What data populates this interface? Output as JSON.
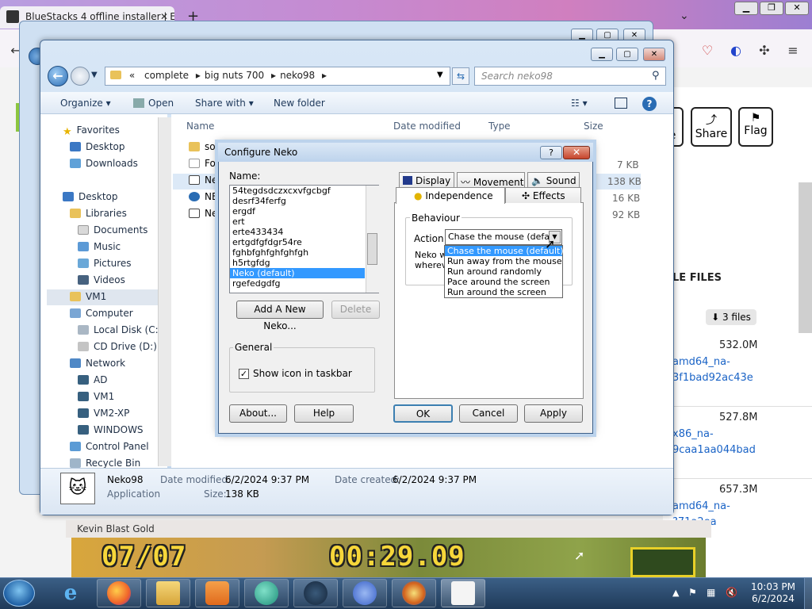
{
  "browser": {
    "tab_title": "BlueStacks 4 offline installer | E",
    "tab_close": "✕",
    "new_tab": "+",
    "page_buttons": [
      {
        "icon": "share-icon",
        "label": "Share"
      },
      {
        "icon": "flag-icon",
        "label": "Flag"
      }
    ],
    "partial_button_label": "e",
    "files_heading": "LE FILES",
    "files_count": "3 files",
    "files": [
      {
        "name_lines": [
          "amd64_na-",
          "3f1bad92ac43e"
        ],
        "size": "532.0M"
      },
      {
        "name_lines": [
          "x86_na-",
          "9caa1aa044bad"
        ],
        "size": "527.8M"
      },
      {
        "name_lines": [
          "amd64_na-",
          "?71a2ea"
        ],
        "size": "657.3M"
      }
    ]
  },
  "explorer": {
    "breadcrumb": [
      "«",
      "complete",
      "big nuts 700",
      "neko98"
    ],
    "search_placeholder": "Search neko98",
    "toolbar": {
      "organize": "Organize",
      "open": "Open",
      "share_with": "Share with",
      "new_folder": "New folder"
    },
    "nav": {
      "favorites": "Favorites",
      "desktop_fav": "Desktop",
      "downloads": "Downloads",
      "desktop": "Desktop",
      "libraries": "Libraries",
      "documents": "Documents",
      "music": "Music",
      "pictures": "Pictures",
      "videos": "Videos",
      "vm1_home": "VM1",
      "computer": "Computer",
      "local_disk": "Local Disk (C:)",
      "cd_drive": "CD Drive (D:)",
      "network": "Network",
      "ad": "AD",
      "vm1": "VM1",
      "vm2": "VM2-XP",
      "windows": "WINDOWS",
      "control_panel": "Control Panel",
      "recycle_bin": "Recycle Bin"
    },
    "columns": {
      "name": "Name",
      "date": "Date modified",
      "type": "Type",
      "size": "Size"
    },
    "rows": [
      {
        "name": "sou",
        "size": ""
      },
      {
        "name": "Foo",
        "size": "7 KB"
      },
      {
        "name": "Nek",
        "size": "138 KB"
      },
      {
        "name": "NEK",
        "size": "16 KB"
      },
      {
        "name": "Nek",
        "size": "92 KB"
      }
    ],
    "details": {
      "name": "Neko98",
      "kind": "Application",
      "modified_label": "Date modified:",
      "modified": "6/2/2024 9:37 PM",
      "created_label": "Date created:",
      "created": "6/2/2024 9:37 PM",
      "size_label": "Size:",
      "size": "138 KB"
    }
  },
  "dialog": {
    "title": "Configure Neko",
    "help_q": "?",
    "close": "✕",
    "name_label": "Name:",
    "names": [
      "54tegdsdczxcxvfgcbgf",
      "desrf34ferfg",
      "ergdf",
      "ert",
      "erte433434",
      "ertgdfgfdgr54re",
      "fghbfghfghfghfgh",
      "h5rtgfdg",
      "Neko (default)",
      "rgefedgdfg"
    ],
    "selected_name": "Neko (default)",
    "add_button": "Add A New Neko...",
    "delete_button": "Delete",
    "general_label": "General",
    "show_icon_label": "Show icon in taskbar",
    "show_icon_checked": true,
    "about_button": "About...",
    "help_button": "Help",
    "ok_button": "OK",
    "cancel_button": "Cancel",
    "apply_button": "Apply",
    "tabs": {
      "display": "Display",
      "movement": "Movement",
      "sound": "Sound",
      "independence": "Independence",
      "effects": "Effects"
    },
    "behaviour_label": "Behaviour",
    "action_label": "Action:",
    "action_value": "Chase the mouse (default)",
    "desc_line1": "Neko w",
    "desc_line2": "wherev",
    "action_options": [
      "Chase the mouse (default)",
      "Run away from the mouse",
      "Run around randomly",
      "Pace around the screen",
      "Run around the screen"
    ]
  },
  "video": {
    "channel": "Kevin Blast Gold",
    "score": "07/07",
    "timer": "00:29.09"
  },
  "taskbar": {
    "time": "10:03 PM",
    "date": "6/2/2024"
  }
}
